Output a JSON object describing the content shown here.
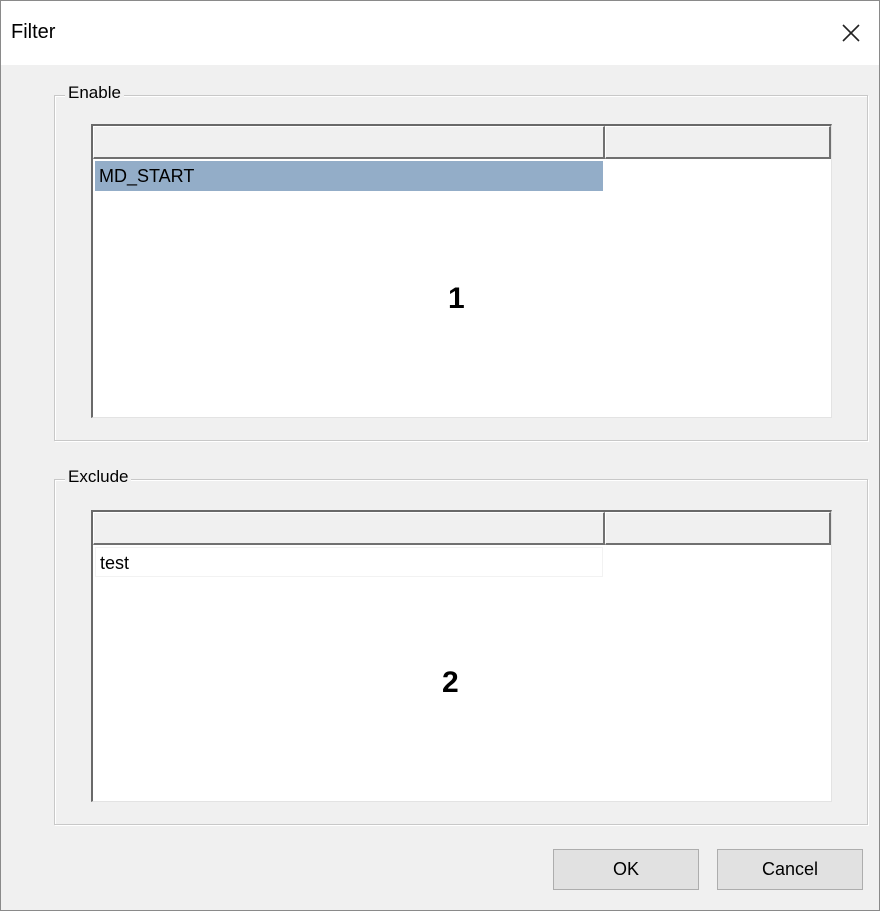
{
  "window": {
    "title": "Filter",
    "close_icon": "close-icon"
  },
  "enable_group": {
    "label": "Enable",
    "rows": [
      {
        "text": "MD_START",
        "selected": true
      }
    ],
    "overlay_number": "1"
  },
  "exclude_group": {
    "label": "Exclude",
    "rows": [
      {
        "text": "test",
        "selected": false
      }
    ],
    "overlay_number": "2"
  },
  "buttons": {
    "ok_label": "OK",
    "cancel_label": "Cancel"
  },
  "colors": {
    "selection": "#93adc8",
    "dialog_background": "#f0f0f0"
  }
}
